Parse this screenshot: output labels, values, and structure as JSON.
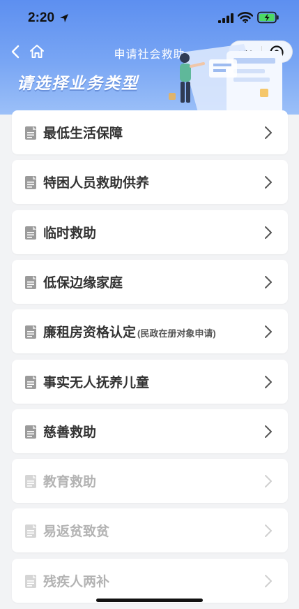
{
  "status_bar": {
    "time": "2:20"
  },
  "nav": {
    "title": "申请社会救助"
  },
  "banner": {
    "heading": "请选择业务类型"
  },
  "items": [
    {
      "label": "最低生活保障",
      "note": "",
      "enabled": true
    },
    {
      "label": "特困人员救助供养",
      "note": "",
      "enabled": true
    },
    {
      "label": "临时救助",
      "note": "",
      "enabled": true
    },
    {
      "label": "低保边缘家庭",
      "note": "",
      "enabled": true
    },
    {
      "label": "廉租房资格认定",
      "note": "(民政在册对象申请)",
      "enabled": true
    },
    {
      "label": "事实无人抚养儿童",
      "note": "",
      "enabled": true
    },
    {
      "label": "慈善救助",
      "note": "",
      "enabled": true
    },
    {
      "label": "教育救助",
      "note": "",
      "enabled": false
    },
    {
      "label": "易返贫致贫",
      "note": "",
      "enabled": false
    },
    {
      "label": "残疾人两补",
      "note": "",
      "enabled": false
    }
  ],
  "colors": {
    "header_top": "#5d8ff0",
    "header_bottom": "#9cc0f8",
    "page_bg": "#f2f3f5",
    "text": "#333333",
    "disabled_text": "#b3b3b3",
    "battery": "#4cd964"
  }
}
